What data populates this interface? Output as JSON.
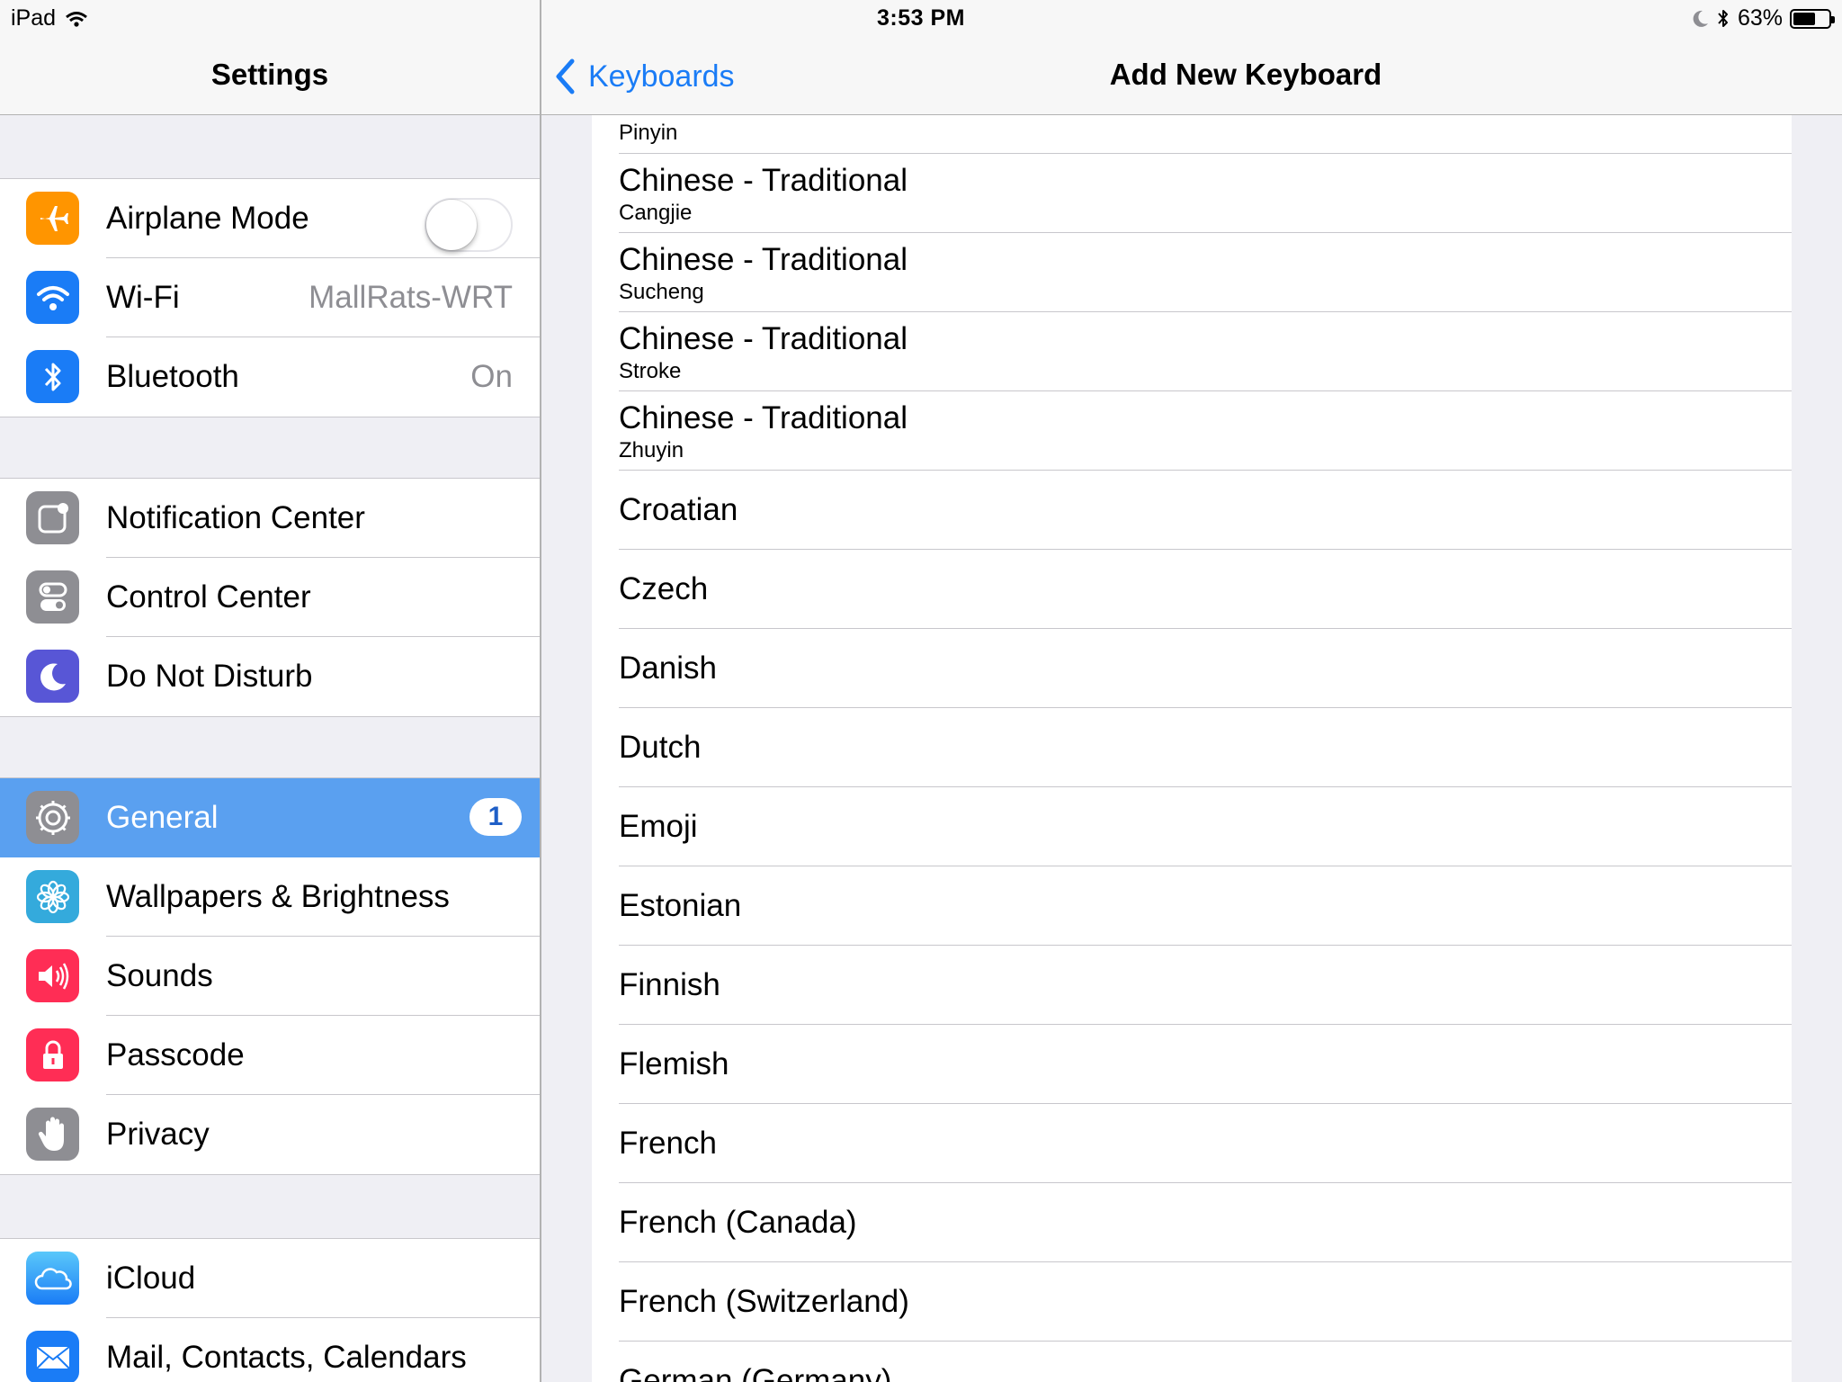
{
  "status_bar": {
    "device": "iPad",
    "time": "3:53 PM",
    "battery_percent": "63%",
    "battery_level": 0.63,
    "icons": [
      "wifi-icon",
      "moon-icon",
      "bluetooth-icon",
      "battery-icon"
    ]
  },
  "master": {
    "title": "Settings",
    "groups": [
      {
        "rows": [
          {
            "label": "Airplane Mode",
            "icon": "airplane-icon",
            "icon_color": "#ff9500",
            "toggle": false
          },
          {
            "label": "Wi-Fi",
            "icon": "wifi-icon",
            "icon_color": "#1a7cf6",
            "value": "MallRats-WRT"
          },
          {
            "label": "Bluetooth",
            "icon": "bluetooth-icon",
            "icon_color": "#1a7cf6",
            "value": "On"
          }
        ]
      },
      {
        "rows": [
          {
            "label": "Notification Center",
            "icon": "notification-center-icon",
            "icon_color": "#8e8e93"
          },
          {
            "label": "Control Center",
            "icon": "control-center-icon",
            "icon_color": "#8e8e93"
          },
          {
            "label": "Do Not Disturb",
            "icon": "moon-icon",
            "icon_color": "#5856d6"
          }
        ]
      },
      {
        "rows": [
          {
            "label": "General",
            "icon": "gear-icon",
            "icon_color": "#8e8e93",
            "badge": "1",
            "selected": true
          },
          {
            "label": "Wallpapers & Brightness",
            "icon": "flower-icon",
            "icon_color": "#34aadc"
          },
          {
            "label": "Sounds",
            "icon": "speaker-icon",
            "icon_color": "#ff2d55"
          },
          {
            "label": "Passcode",
            "icon": "lock-icon",
            "icon_color": "#ff2d55"
          },
          {
            "label": "Privacy",
            "icon": "hand-icon",
            "icon_color": "#8e8e93"
          }
        ]
      },
      {
        "rows": [
          {
            "label": "iCloud",
            "icon": "cloud-icon",
            "icon_color": "#34aadc"
          },
          {
            "label": "Mail, Contacts, Calendars",
            "icon": "mail-icon",
            "icon_color": "#1a7cf6"
          }
        ]
      }
    ]
  },
  "detail": {
    "back_label": "Keyboards",
    "title": "Add New Keyboard",
    "keyboards": [
      {
        "sub": "Pinyin",
        "partial": true
      },
      {
        "label": "Chinese - Traditional",
        "sub": "Cangjie"
      },
      {
        "label": "Chinese - Traditional",
        "sub": "Sucheng"
      },
      {
        "label": "Chinese - Traditional",
        "sub": "Stroke"
      },
      {
        "label": "Chinese - Traditional",
        "sub": "Zhuyin"
      },
      {
        "label": "Croatian"
      },
      {
        "label": "Czech"
      },
      {
        "label": "Danish"
      },
      {
        "label": "Dutch"
      },
      {
        "label": "Emoji"
      },
      {
        "label": "Estonian"
      },
      {
        "label": "Finnish"
      },
      {
        "label": "Flemish"
      },
      {
        "label": "French"
      },
      {
        "label": "French (Canada)"
      },
      {
        "label": "French (Switzerland)"
      },
      {
        "label": "German (Germany)"
      }
    ]
  }
}
